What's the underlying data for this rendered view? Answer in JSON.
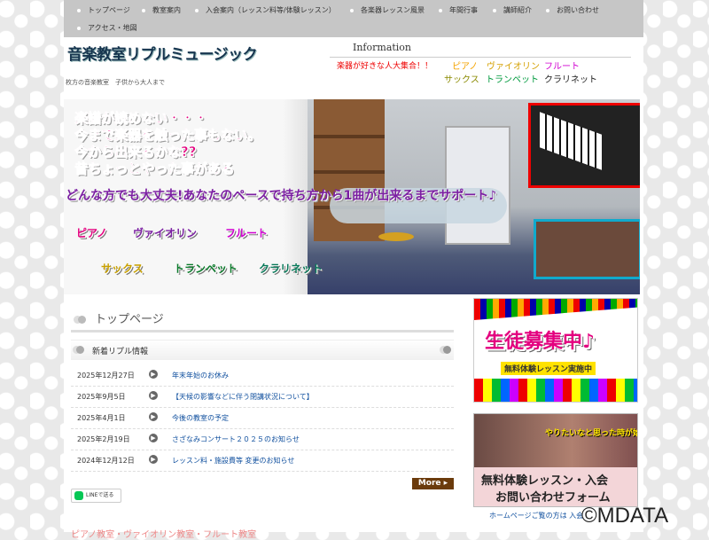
{
  "nav": {
    "items": [
      {
        "label": "トップページ"
      },
      {
        "label": "教室案内"
      },
      {
        "label": "入会案内（レッスン料等/体験レッスン）"
      },
      {
        "label": "各楽器レッスン風景"
      },
      {
        "label": "年間行事"
      },
      {
        "label": "講師紹介"
      },
      {
        "label": "お問い合わせ"
      },
      {
        "label": "アクセス・地図"
      }
    ]
  },
  "header": {
    "logo": "音楽教室リプルミュージック",
    "tagline": "枚方の音楽教室　子供から大人まで",
    "info_heading": "Information",
    "info_text": "楽器が好きな人大集合！！",
    "instruments": [
      {
        "label": "ピアノ",
        "color": "#f4a300"
      },
      {
        "label": "ヴァイオリン",
        "color": "#d4a000"
      },
      {
        "label": "フルート",
        "color": "#d000d0"
      },
      {
        "label": "サックス",
        "color": "#8a8a00"
      },
      {
        "label": "トランペット",
        "color": "#009a3e"
      },
      {
        "label": "クラリネット",
        "color": "#222222"
      }
    ]
  },
  "banner": {
    "lines": [
      "楽譜が読めない・・・",
      "今まで楽器を触った事もない。",
      "今から出来るかな??",
      "昔ちょっとやった事がある"
    ],
    "subline": "どんな方でも大丈夫!あなたのペースで持ち方から1曲が出来るまでサポート♪",
    "instruments": [
      {
        "label": "ピアノ",
        "color": "#e4007f"
      },
      {
        "label": "ヴァイオリン",
        "color": "#7b1fa2"
      },
      {
        "label": "フルート",
        "color": "#d000d0"
      },
      {
        "label": "サックス",
        "color": "#c8a000"
      },
      {
        "label": "トランペット",
        "color": "#0a7a2a"
      },
      {
        "label": "クラリネット",
        "color": "#0a7a5a"
      }
    ]
  },
  "main": {
    "page_title": "トップページ",
    "news_heading": "新着リプル情報",
    "news": [
      {
        "date": "2025年12月27日",
        "title": "年末年始のお休み"
      },
      {
        "date": "2025年9月5日",
        "title": "【天候の影響などに伴う閉講状況について】"
      },
      {
        "date": "2025年4月1日",
        "title": "今後の教室の予定"
      },
      {
        "date": "2025年2月19日",
        "title": "さざなみコンサート２０２５のお知らせ"
      },
      {
        "date": "2024年12月12日",
        "title": "レッスン料・施設費等 変更のお知らせ"
      }
    ],
    "more_label": "More ▸",
    "line_label": "LINEで送る",
    "bottom_text": "ピアノ教室・ヴァイオリン教室・フルート教室"
  },
  "side": {
    "recruit_title": "生徒募集中♪",
    "recruit_sub": "無料体験レッスン実施中",
    "trial_caption": "やりたいなと思った時が始め時",
    "trial_title_1": "無料体験レッスン・入会",
    "trial_title_2": "お問い合わせフォーム",
    "hp_note": "ホームページご覧の方は 入会"
  },
  "copyright": "©MDATA"
}
